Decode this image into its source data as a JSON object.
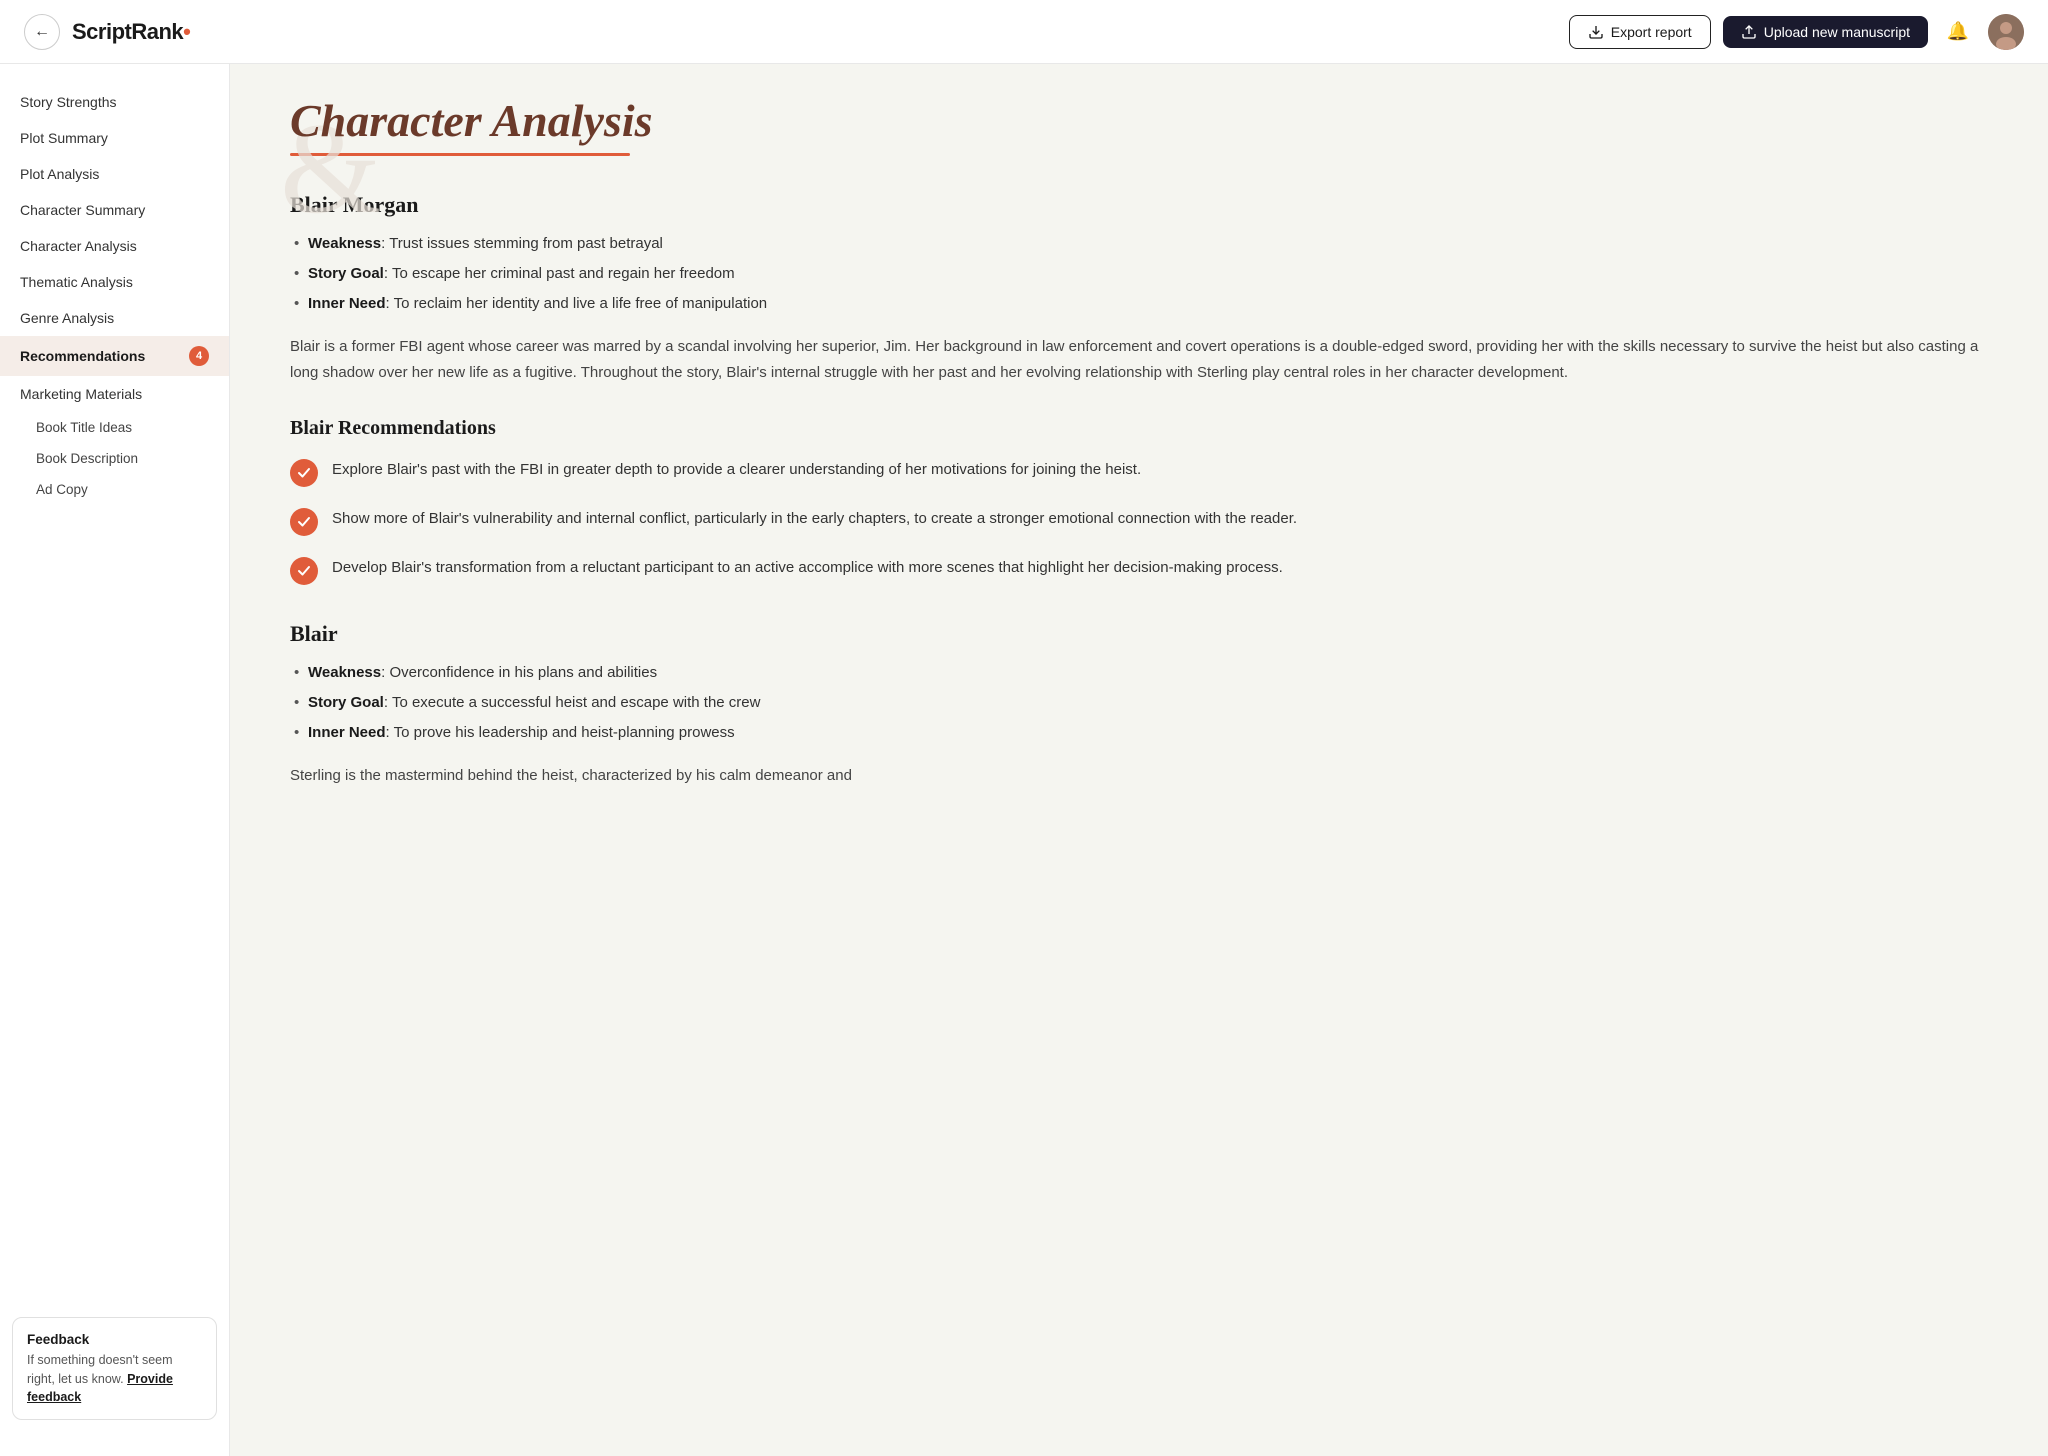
{
  "header": {
    "back_label": "←",
    "logo_text": "ScriptRank",
    "logo_dot": ".",
    "export_label": "Export report",
    "upload_label": "Upload new manuscript"
  },
  "sidebar": {
    "items": [
      {
        "label": "Story Strengths",
        "active": false,
        "badge": null
      },
      {
        "label": "Plot Summary",
        "active": false,
        "badge": null
      },
      {
        "label": "Plot Analysis",
        "active": false,
        "badge": null
      },
      {
        "label": "Character Summary",
        "active": false,
        "badge": null
      },
      {
        "label": "Character Analysis",
        "active": false,
        "badge": null
      },
      {
        "label": "Thematic Analysis",
        "active": false,
        "badge": null
      },
      {
        "label": "Genre Analysis",
        "active": false,
        "badge": null
      },
      {
        "label": "Recommendations",
        "active": true,
        "badge": "4"
      },
      {
        "label": "Marketing Materials",
        "active": false,
        "badge": null
      }
    ],
    "sub_items": [
      {
        "label": "Book Title Ideas"
      },
      {
        "label": "Book Description"
      },
      {
        "label": "Ad Copy"
      }
    ]
  },
  "feedback": {
    "title": "Feedback",
    "text": "If something doesn't seem right, let us know.",
    "link_label": "Provide feedback"
  },
  "main": {
    "page_title": "Character Analysis",
    "characters": [
      {
        "name": "Blair Morgan",
        "weakness": "Trust issues stemming from past betrayal",
        "story_goal": "To escape her criminal past and regain her freedom",
        "inner_need": "To reclaim her identity and live a life free of manipulation",
        "description": "Blair is a former FBI agent whose career was marred by a scandal involving her superior, Jim. Her background in law enforcement and covert operations is a double-edged sword, providing her with the skills necessary to survive the heist but also casting a long shadow over her new life as a fugitive. Throughout the story, Blair's internal struggle with her past and her evolving relationship with Sterling play central roles in her character development.",
        "rec_title": "Blair Recommendations",
        "recommendations": [
          "Explore Blair's past with the FBI in greater depth to provide a clearer understanding of her motivations for joining the heist.",
          "Show more of Blair's vulnerability and internal conflict, particularly in the early chapters, to create a stronger emotional connection with the reader.",
          "Develop Blair's transformation from a reluctant participant to an active accomplice with more scenes that highlight her decision-making process."
        ]
      },
      {
        "name": "Blair",
        "weakness": "Overconfidence in his plans and abilities",
        "story_goal": "To execute a successful heist and escape with the crew",
        "inner_need": "To prove his leadership and heist-planning prowess",
        "description": "Sterling is the mastermind behind the heist, characterized by his calm demeanor and"
      }
    ]
  }
}
